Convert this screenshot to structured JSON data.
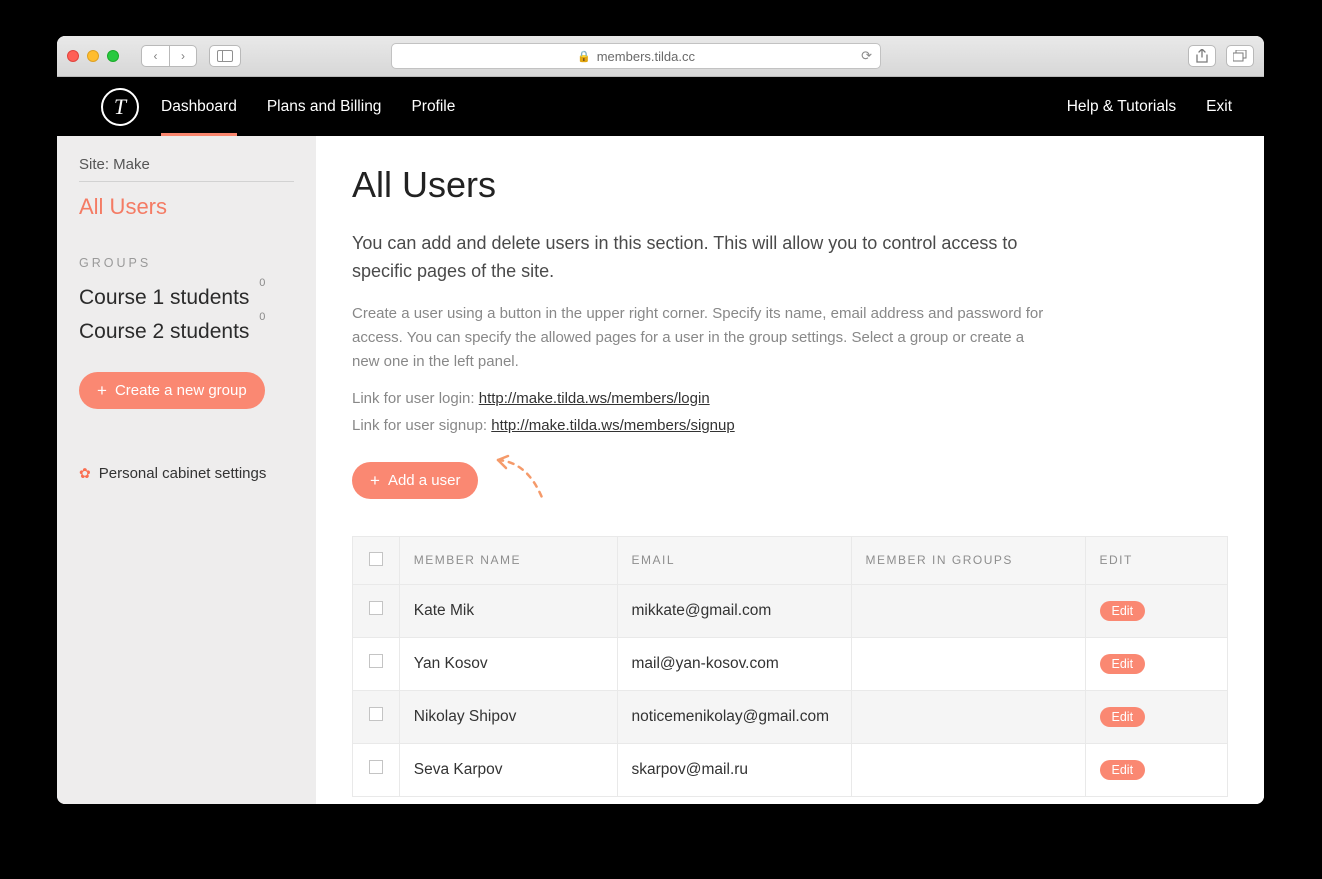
{
  "browser": {
    "url": "members.tilda.cc"
  },
  "nav": {
    "items": [
      "Dashboard",
      "Plans and Billing",
      "Profile"
    ],
    "right": [
      "Help & Tutorials",
      "Exit"
    ]
  },
  "sidebar": {
    "site_label": "Site: Make",
    "all_users_label": "All Users",
    "groups_heading": "GROUPS",
    "groups": [
      {
        "name": "Course 1 students",
        "count": "0"
      },
      {
        "name": "Course 2 students",
        "count": "0"
      }
    ],
    "create_group_label": "Create a new group",
    "personal_cabinet_label": "Personal cabinet settings"
  },
  "main": {
    "title": "All Users",
    "intro": "You can add and delete users in this section. This will allow you to control access to specific pages of the site.",
    "hint": "Create a user using a button in the upper right corner. Specify its name, email address and password for access. You can specify the allowed pages for a user in the group settings. Select a group or create a new one in the left panel.",
    "login_line_prefix": "Link for user login: ",
    "login_link": "http://make.tilda.ws/members/login",
    "signup_line_prefix": "Link for user signup: ",
    "signup_link": "http://make.tilda.ws/members/signup",
    "add_user_label": "Add a user"
  },
  "table": {
    "headers": {
      "name": "MEMBER NAME",
      "email": "EMAIL",
      "groups": "MEMBER IN GROUPS",
      "edit": "EDIT"
    },
    "edit_label": "Edit",
    "rows": [
      {
        "name": "Kate Mik",
        "email": "mikkate@gmail.com",
        "groups": ""
      },
      {
        "name": "Yan Kosov",
        "email": "mail@yan-kosov.com",
        "groups": ""
      },
      {
        "name": "Nikolay Shipov",
        "email": "noticemenikolay@gmail.com",
        "groups": ""
      },
      {
        "name": "Seva Karpov",
        "email": "skarpov@mail.ru",
        "groups": ""
      }
    ]
  }
}
